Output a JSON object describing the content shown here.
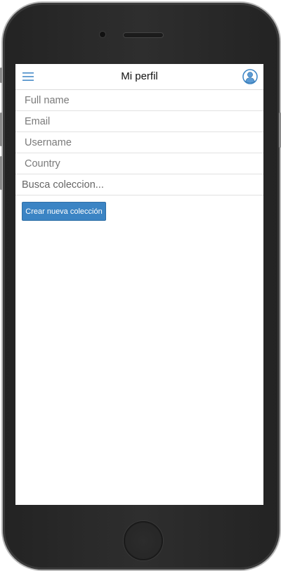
{
  "header": {
    "title": "Mi perfil",
    "menu_icon": "hamburger-menu-icon",
    "profile_icon": "user-profile-icon",
    "accent": "#3b84c4"
  },
  "fields": {
    "full_name": "Full name",
    "email": "Email",
    "username": "Username",
    "country": "Country"
  },
  "search": {
    "placeholder": "Busca coleccion..."
  },
  "actions": {
    "create_label": "Crear nueva colección"
  }
}
